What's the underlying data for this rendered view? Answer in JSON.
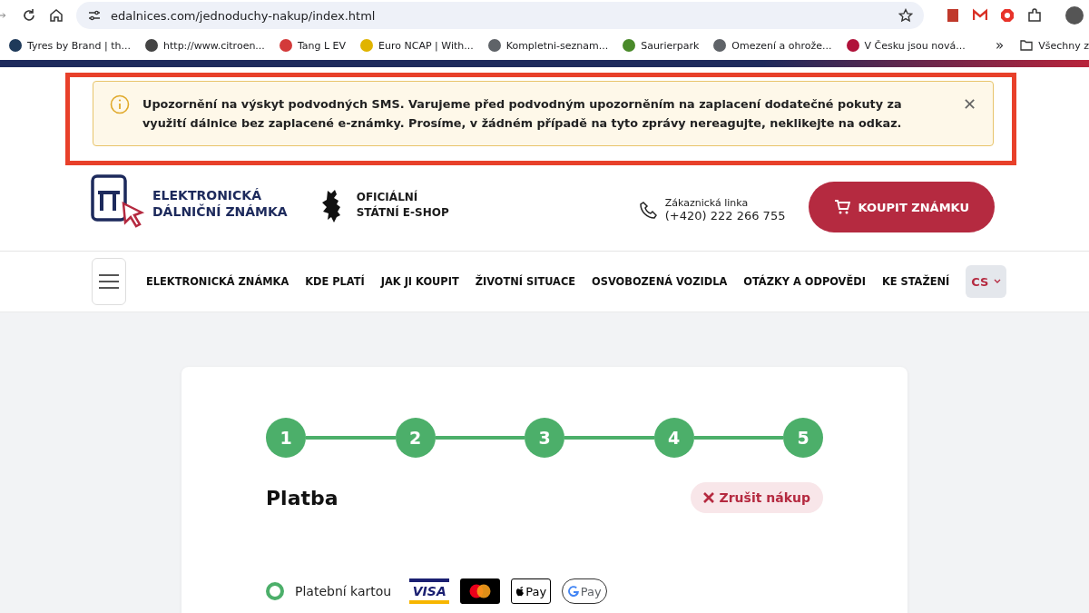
{
  "browser": {
    "url": "edalnices.com/jednoduchy-nakup/index.html",
    "bookmarks": [
      {
        "label": "Tyres by Brand | th...",
        "color": "#1f3a5a"
      },
      {
        "label": "http://www.citroen...",
        "color": "#444444"
      },
      {
        "label": "Tang L EV",
        "color": "#d33a3a"
      },
      {
        "label": "Euro NCAP | With...",
        "color": "#e0b400"
      },
      {
        "label": "Kompletni-seznam...",
        "color": "#5f6368"
      },
      {
        "label": "Saurierpark",
        "color": "#4a8a2a"
      },
      {
        "label": "Omezení a ohrože...",
        "color": "#5f6368"
      },
      {
        "label": "V Česku jsou nová...",
        "color": "#b0123a"
      }
    ],
    "overflow": "»",
    "folder": "Všechny z"
  },
  "alert": {
    "text": "Upozornění na výskyt podvodných SMS. Varujeme před podvodným upozorněním na zaplacení dodatečné pokuty za využití dálnice bez zaplacené e-známky. Prosíme, v žádném případě na tyto zprávy nereagujte, neklikejte na odkaz.",
    "close": "✕"
  },
  "header": {
    "logo_lines": [
      "ELEKTRONICKÁ",
      "DÁLNIČNÍ ZNÁMKA"
    ],
    "official_lines": [
      "OFICIÁLNÍ",
      "STÁTNÍ E-SHOP"
    ],
    "phone_label": "Zákaznická linka",
    "phone": "(+420) 222 266 755",
    "buy_button": "KOUPIT ZNÁMKU"
  },
  "nav": {
    "items": [
      "ELEKTRONICKÁ ZNÁMKA",
      "KDE PLATÍ",
      "JAK JI KOUPIT",
      "ŽIVOTNÍ SITUACE",
      "OSVOBOZENÁ VOZIDLA",
      "OTÁZKY A ODPOVĚDI",
      "KE STAŽENÍ"
    ],
    "language": "CS"
  },
  "checkout": {
    "steps": [
      "1",
      "2",
      "3",
      "4",
      "5"
    ],
    "title": "Platba",
    "cancel": "Zrušit nákup",
    "payment_options": [
      {
        "label": "Platební kartou",
        "selected": true
      }
    ],
    "card_logos": [
      {
        "kind": "visa",
        "text": "VISA"
      },
      {
        "kind": "mastercard"
      },
      {
        "kind": "applepay",
        "text": "Pay"
      },
      {
        "kind": "googlepay",
        "text": "Pay"
      }
    ]
  }
}
